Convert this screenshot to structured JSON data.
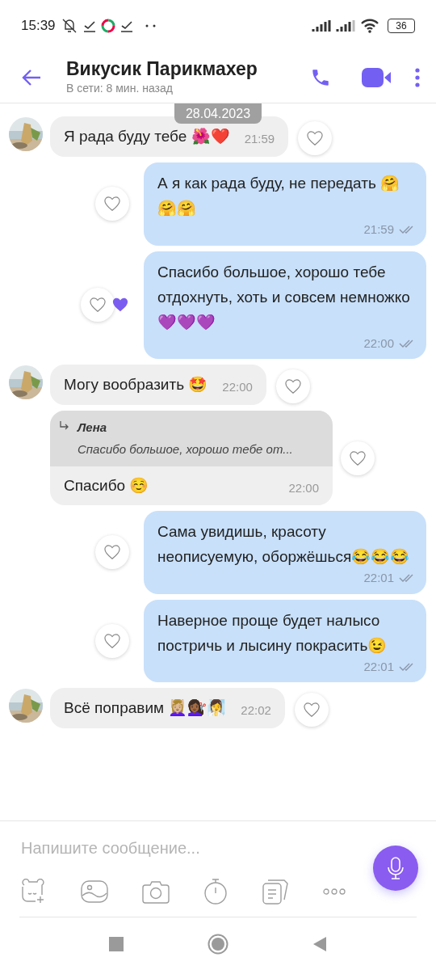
{
  "status_bar": {
    "time": "15:39",
    "battery": "36"
  },
  "header": {
    "title": "Викусик Парикмахер",
    "subtitle": "В сети: 8 мин. назад"
  },
  "date_pill": "28.04.2023",
  "messages": [
    {
      "kind": "incoming",
      "text": "Я рада буду тебе 🌺❤️",
      "time": "21:59",
      "liked": false
    },
    {
      "kind": "outgoing",
      "text": "А я как рада буду, не передать 🤗🤗🤗",
      "time": "21:59",
      "liked": false
    },
    {
      "kind": "outgoing",
      "text": "Спасибо большое, хорошо тебе отдохнуть, хоть и совсем немножко 💜💜💜",
      "time": "22:00",
      "liked": true
    },
    {
      "kind": "incoming",
      "text": "Могу вообразить 🤩",
      "time": "22:00",
      "liked": false
    },
    {
      "kind": "reply",
      "quote_author": "Лена",
      "quote_text": "Спасибо большое, хорошо тебе от...",
      "text": "Спасибо ☺️",
      "time": "22:00",
      "liked": false
    },
    {
      "kind": "outgoing",
      "text": "Сама увидишь, красоту неописуемую, оборжёшься😂😂😂",
      "time": "22:01",
      "liked": false
    },
    {
      "kind": "outgoing",
      "text": "Наверное проще будет налысо постричь и лысину покрасить😉",
      "time": "22:01",
      "liked": false
    },
    {
      "kind": "incoming",
      "text": "Всё поправим 💆🏼‍♀️💇🏾‍♀️🧖‍♀️",
      "time": "22:02",
      "liked": false
    }
  ],
  "composer": {
    "placeholder": "Напишите сообщение..."
  }
}
